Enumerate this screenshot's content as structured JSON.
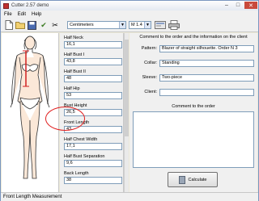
{
  "window": {
    "title": "Cutter 2.57 demo",
    "minimize": "–",
    "maximize": "□",
    "close": "✕"
  },
  "menu": [
    "File",
    "Edit",
    "Help"
  ],
  "toolbar": {
    "units_value": "Centimeters",
    "size_value": "М 1.4",
    "icons": [
      "new-file-icon",
      "open-folder-icon",
      "save-icon",
      "check-icon",
      "scissors-icon",
      "settings-icon",
      "print-icon"
    ]
  },
  "measurements": [
    {
      "label": "Half Neck",
      "value": "16,1"
    },
    {
      "label": "Half Bust I",
      "value": "43,8"
    },
    {
      "label": "Half Bust II",
      "value": "48"
    },
    {
      "label": "Half Hip",
      "value": "53"
    },
    {
      "label": "Bust Height",
      "value": "26,5"
    },
    {
      "label": "Front Length",
      "value": "43"
    },
    {
      "label": "Half Chest Width",
      "value": "17,1"
    },
    {
      "label": "Half Bust Separation",
      "value": "9,6"
    },
    {
      "label": "Back Length",
      "value": "38"
    }
  ],
  "order": {
    "header": "Comment to the order and the information on the client",
    "pattern_label": "Pattern:",
    "pattern_value": "Blazer of straight silhouette. Order N 3",
    "collar_label": "Collar:",
    "collar_value": "Standing",
    "sleeve_label": "Sleeve:",
    "sleeve_value": "Two-piece",
    "client_label": "Client:",
    "client_value": "",
    "comment_header": "Comment to the order",
    "comment_value": ""
  },
  "calculate_label": "Calculate",
  "status": "Front Length Measurement",
  "colors": {
    "highlight_ring": "#e02020",
    "measure_line": "#d02020"
  }
}
